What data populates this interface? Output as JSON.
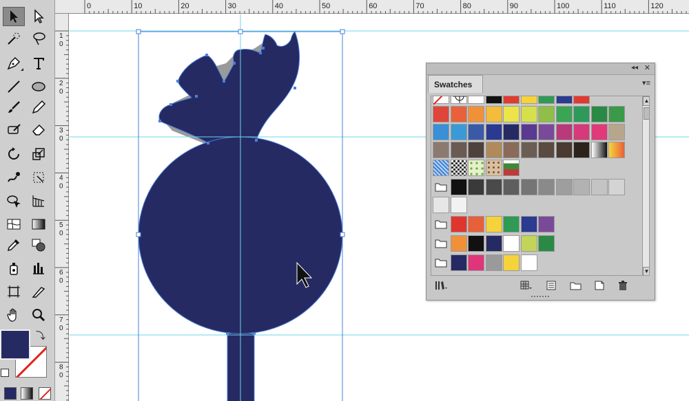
{
  "ruler": {
    "top_labels": [
      "0",
      "10",
      "20",
      "30",
      "40",
      "50",
      "60",
      "70",
      "80",
      "90",
      "100",
      "110",
      "120"
    ],
    "left_labels": [
      "1",
      "0",
      "2",
      "0",
      "3",
      "0",
      "4",
      "0",
      "5",
      "0",
      "6",
      "0",
      "7",
      "0",
      "8",
      "0"
    ]
  },
  "panel": {
    "title": "Swatches",
    "collapse_glyph": "◂◂",
    "close_glyph": "✕",
    "menu_glyph": "▾≡"
  },
  "colors": {
    "fill": "#262a63",
    "guide": "#6fd4ea",
    "selection": "#4a7fd8",
    "shadow": "#9a9a9a"
  },
  "swatches": {
    "row0": [
      "none",
      "registration",
      "#ffffff",
      "#111111",
      "#e23a2e",
      "#f6d33a",
      "#2f9a55",
      "#2b3b8f",
      "#e23a2e"
    ],
    "row1": [
      "#e0453a",
      "#e8613a",
      "#f0913a",
      "#f3bc3a",
      "#ece448",
      "#d6e04a",
      "#8fbf48",
      "#3aa555",
      "#2e9a5a",
      "#2a8a45",
      "#3a9a4a"
    ],
    "row2": [
      "#3a8fd6",
      "#3a9ad8",
      "#3a5aa8",
      "#2a3a90",
      "#262a63",
      "#5a3a90",
      "#7a4a9a",
      "#b83a7a",
      "#d63a7a",
      "#e03a7a",
      "#b8a68c"
    ],
    "row3": [
      "#8c7a70",
      "#6a5a52",
      "#4e423c",
      "#b08a5a",
      "#8a6a58",
      "#6a5e54",
      "#5a4a40",
      "#4a3a32",
      "#2e221c",
      "gradient-bw",
      "gradient-orange"
    ],
    "row4": [
      "pattern-blue",
      "pattern-check",
      "pattern-green",
      "pattern-floral",
      "pattern-leaf"
    ],
    "grays": [
      "#111111",
      "#3a3a3a",
      "#4a4a4a",
      "#5e5e5e",
      "#757575",
      "#8a8a8a",
      "#9e9e9e",
      "#b2b2b2",
      "#c4c4c4",
      "#d4d4d4",
      "#e6e6e6",
      "#f2f2f2"
    ],
    "group1": [
      "#e0352e",
      "#e8603a",
      "#f6d33a",
      "#2f9a55",
      "#2b3b8f",
      "#7a4a9a"
    ],
    "group2": [
      "#f0913a",
      "#111111",
      "#262a63",
      "#ffffff",
      "#c2d45a",
      "#2a8a45"
    ],
    "group3": [
      "#262a63",
      "#e0357a",
      "#9a9a9a",
      "#f6d33a",
      "#ffffff"
    ]
  },
  "toolbar": {
    "tools": [
      "selection-tool",
      "direct-selection-tool",
      "magic-wand-tool",
      "lasso-tool",
      "pen-tool",
      "type-tool",
      "line-tool",
      "ellipse-tool",
      "paintbrush-tool",
      "pencil-tool",
      "shape-builder-tool",
      "eraser-tool",
      "rotate-tool",
      "scale-tool",
      "warp-tool",
      "free-transform-tool",
      "shape-builder-tool-2",
      "perspective-grid-tool",
      "mesh-tool",
      "gradient-tool",
      "eyedropper-tool",
      "blend-tool",
      "symbol-sprayer-tool",
      "column-graph-tool",
      "artboard-tool",
      "slice-tool",
      "hand-tool",
      "zoom-tool"
    ]
  },
  "canvas": {
    "artwork": "hibiscus-bud-navy",
    "cursor": "arrow-cursor"
  }
}
